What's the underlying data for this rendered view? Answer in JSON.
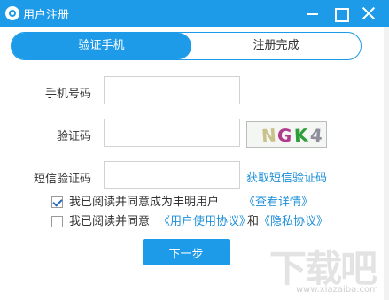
{
  "window": {
    "title": "用户注册"
  },
  "steps": {
    "active": "验证手机",
    "inactive": "注册完成"
  },
  "form": {
    "phone_label": "手机号码",
    "phone_value": "",
    "code_label": "验证码",
    "code_value": "",
    "captcha_chars": [
      {
        "ch": "N",
        "color": "#c9c38a"
      },
      {
        "ch": "G",
        "color": "#b23a8a"
      },
      {
        "ch": "K",
        "color": "#2e9e3a"
      },
      {
        "ch": "4",
        "color": "#8f8f9c"
      }
    ],
    "sms_label": "短信验证码",
    "sms_value": "",
    "get_sms_link": "获取短信验证码"
  },
  "agreements": {
    "agree_member_checked": true,
    "agree_member_text": "我已阅读并同意成为丰明用户",
    "view_details_link": "《查看详情》",
    "agree_terms_checked": false,
    "agree_terms_text": "我已阅读并同意",
    "user_agreement_link": "《用户使用协议》",
    "and_text": "和",
    "privacy_link": "《隐私协议》"
  },
  "next_button": "下一步",
  "watermark": {
    "text": "下载吧",
    "url": "www.xiazaiba.com"
  },
  "colors": {
    "accent": "#1e9be8",
    "link": "#1e8fd8"
  }
}
